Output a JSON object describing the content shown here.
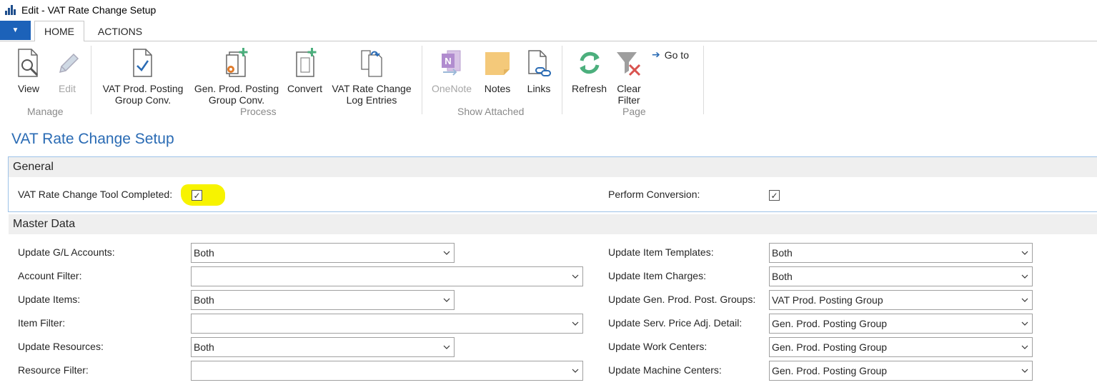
{
  "window": {
    "title": "Edit - VAT Rate Change Setup"
  },
  "tabs": {
    "menu_glyph": "▼",
    "home": "HOME",
    "actions": "ACTIONS"
  },
  "ribbon": {
    "view": "View",
    "edit": "Edit",
    "manage_group": "Manage",
    "vat_prod_line1": "VAT Prod. Posting",
    "vat_prod_line2": "Group Conv.",
    "gen_prod_line1": "Gen. Prod. Posting",
    "gen_prod_line2": "Group Conv.",
    "convert": "Convert",
    "vat_log_line1": "VAT Rate Change",
    "vat_log_line2": "Log Entries",
    "process_group": "Process",
    "onenote": "OneNote",
    "notes": "Notes",
    "links": "Links",
    "show_attached_group": "Show Attached",
    "refresh": "Refresh",
    "clear_filter_line1": "Clear",
    "clear_filter_line2": "Filter",
    "goto": "Go to",
    "page_group": "Page"
  },
  "page": {
    "title": "VAT Rate Change Setup"
  },
  "general": {
    "header": "General",
    "tool_completed_label": "VAT Rate Change Tool Completed:",
    "tool_completed_checked": true,
    "perform_conversion_label": "Perform Conversion:",
    "perform_conversion_checked": true
  },
  "master_data": {
    "header": "Master Data",
    "left": [
      {
        "label": "Update G/L Accounts:",
        "value": "Both"
      },
      {
        "label": "Account Filter:",
        "value": ""
      },
      {
        "label": "Update Items:",
        "value": "Both"
      },
      {
        "label": "Item Filter:",
        "value": ""
      },
      {
        "label": "Update Resources:",
        "value": "Both"
      },
      {
        "label": "Resource Filter:",
        "value": ""
      }
    ],
    "right": [
      {
        "label": "Update Item Templates:",
        "value": "Both"
      },
      {
        "label": "Update Item Charges:",
        "value": "Both"
      },
      {
        "label": "Update Gen. Prod. Post. Groups:",
        "value": "VAT Prod. Posting Group"
      },
      {
        "label": "Update Serv. Price Adj. Detail:",
        "value": "Gen. Prod. Posting Group"
      },
      {
        "label": "Update Work Centers:",
        "value": "Gen. Prod. Posting Group"
      },
      {
        "label": "Update Machine Centers:",
        "value": "Gen. Prod. Posting Group"
      }
    ]
  },
  "colors": {
    "accent": "#2a6bb4",
    "menu_button": "#1c62b9",
    "highlight": "#f7f300"
  }
}
